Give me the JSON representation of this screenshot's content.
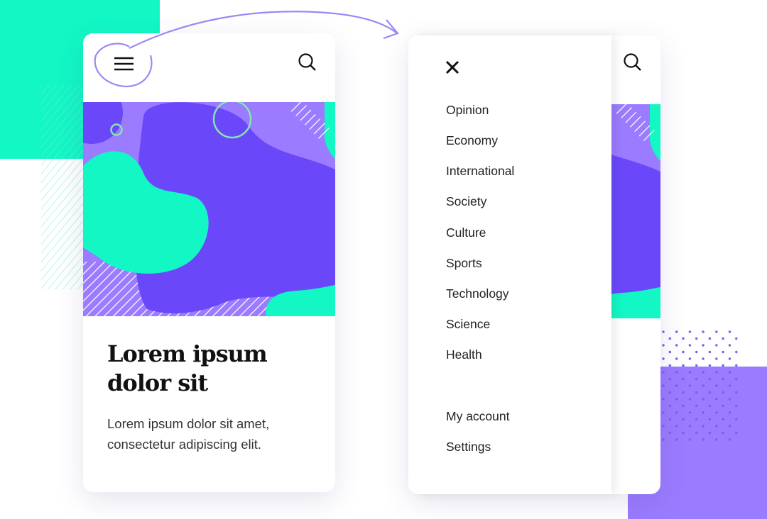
{
  "colors": {
    "teal": "#12f7c4",
    "purple_light": "#9b7bff",
    "purple_dark": "#6a48fa",
    "accent_arrow": "#9d86f5"
  },
  "article": {
    "title_line1": "Lorem ipsum",
    "title_line2": "dolor sit",
    "body_line1": "Lorem ipsum dolor sit amet,",
    "body_line2": "consectetur adipiscing elit."
  },
  "header": {
    "menu_icon": "hamburger-icon",
    "search_icon": "search-icon"
  },
  "drawer": {
    "close_icon": "close-icon",
    "items": [
      "Opinion",
      "Economy",
      "International",
      "Society",
      "Culture",
      "Sports",
      "Technology",
      "Science",
      "Health"
    ],
    "account_items": [
      "My account",
      "Settings"
    ]
  }
}
